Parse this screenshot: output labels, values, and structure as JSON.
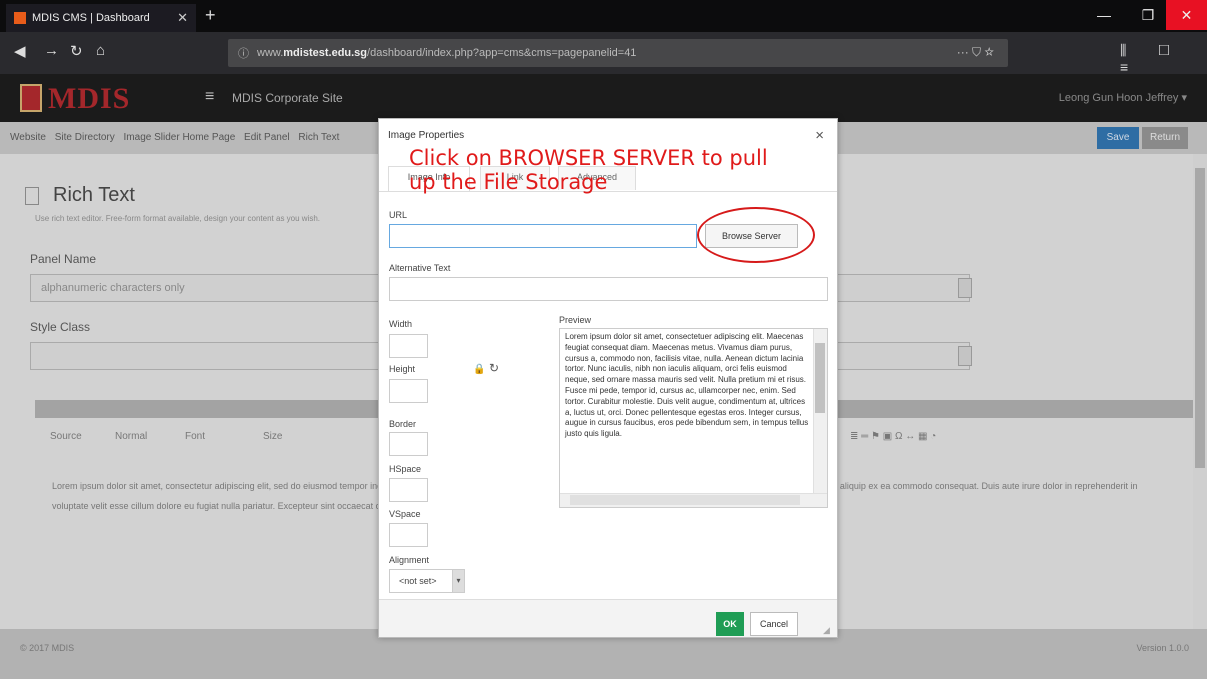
{
  "browser": {
    "tab_title": "MDIS CMS | Dashboard",
    "url_prefix": "www.",
    "url_domain": "mdistest.edu.sg",
    "url_path": "/dashboard/index.php?app=cms&cms=pagepanelid=41",
    "page_actions": "··· ⛉ ☆"
  },
  "cms": {
    "logo_text": "MDIS",
    "site_name": "MDIS Corporate Site",
    "user_menu": "Leong Gun Hoon Jeffrey ▾"
  },
  "breadcrumb": {
    "items": [
      "Website",
      "Site Directory",
      "Image Slider Home Page",
      "Edit Panel",
      "Rich Text"
    ],
    "save_label": "Save",
    "return_label": "Return"
  },
  "page": {
    "title": "Rich Text",
    "subtitle": "Use rich text editor. Free-form format available, design your content as you wish.",
    "panel_name_label": "Panel Name",
    "panel_name_placeholder": "alphanumeric characters only",
    "style_class_label": "Style Class",
    "toolbar": [
      "Source",
      "Normal",
      "Font",
      "Size"
    ],
    "editor_text": "Lorem ipsum dolor sit amet, consectetur adipiscing elit, sed do eiusmod tempor incididunt ut labore et dolore magna aliqua. Ut enim ad minim veniam, quis nostrud exercitation ullamco laboris nisi ut aliquip ex ea commodo consequat. Duis aute irure dolor in reprehenderit in voluptate velit esse cillum dolore eu fugiat nulla pariatur. Excepteur sint occaecat cupidatat non proident, sunt in culpa qui officia deserunt mollit anim id est laborum.",
    "copyright": "© 2017 MDIS",
    "version": "Version 1.0.0"
  },
  "dialog": {
    "title": "Image Properties",
    "close": "×",
    "tabs": [
      "Image Info",
      "Link",
      "Advanced"
    ],
    "url_label": "URL",
    "url_value": "",
    "browse_button": "Browse Server",
    "alt_label": "Alternative Text",
    "width_label": "Width",
    "height_label": "Height",
    "border_label": "Border",
    "hspace_label": "HSpace",
    "vspace_label": "VSpace",
    "alignment_label": "Alignment",
    "alignment_value": "<not set>",
    "preview_label": "Preview",
    "preview_text": "Lorem ipsum dolor sit amet, consectetuer adipiscing elit. Maecenas feugiat consequat diam. Maecenas metus. Vivamus diam purus, cursus a, commodo non, facilisis vitae, nulla. Aenean dictum lacinia tortor. Nunc iaculis, nibh non iaculis aliquam, orci felis euismod neque, sed ornare massa mauris sed velit. Nulla pretium mi et risus. Fusce mi pede, tempor id, cursus ac, ullamcorper nec, enim. Sed tortor. Curabitur molestie. Duis velit augue, condimentum at, ultrices a, luctus ut, orci. Donec pellentesque egestas eros. Integer cursus, augue in cursus faucibus, eros pede bibendum sem, in tempus tellus justo quis ligula.",
    "ok_button": "OK",
    "cancel_button": "Cancel"
  },
  "annotation": {
    "text": "Click on BROWSER SERVER to pull up the File Storage",
    "color": "#e01a1a"
  }
}
